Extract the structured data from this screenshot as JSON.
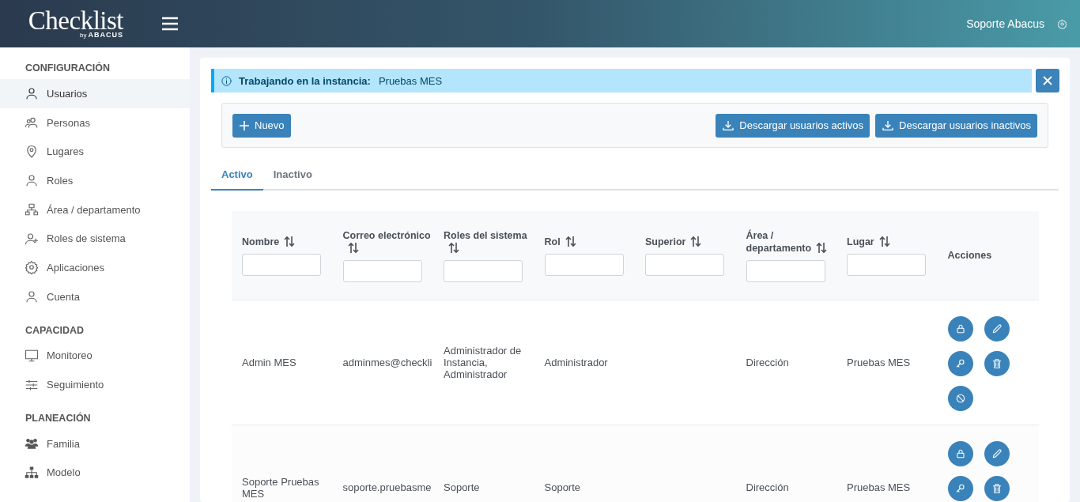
{
  "header": {
    "logo": {
      "title": "Checklist",
      "by": "by",
      "brand": "ABACUS"
    },
    "user": "Soporte Abacus"
  },
  "sidebar": {
    "sections": [
      {
        "title": "CONFIGURACIÓN",
        "items": [
          {
            "label": "Usuarios",
            "kind": "user",
            "selected": true
          },
          {
            "label": "Personas",
            "kind": "users",
            "selected": false
          },
          {
            "label": "Lugares",
            "kind": "pin",
            "selected": false
          },
          {
            "label": "Roles",
            "kind": "user",
            "selected": false
          },
          {
            "label": "Área / departamento",
            "kind": "org",
            "selected": false
          },
          {
            "label": "Roles de sistema",
            "kind": "userplus",
            "selected": false
          },
          {
            "label": "Aplicaciones",
            "kind": "gear",
            "selected": false
          },
          {
            "label": "Cuenta",
            "kind": "user",
            "selected": false
          }
        ]
      },
      {
        "title": "CAPACIDAD",
        "items": [
          {
            "label": "Monitoreo",
            "kind": "monitor",
            "selected": false
          },
          {
            "label": "Seguimiento",
            "kind": "sliders",
            "selected": false
          }
        ]
      },
      {
        "title": "PLANEACIÓN",
        "items": [
          {
            "label": "Familia",
            "kind": "group",
            "selected": false
          },
          {
            "label": "Modelo",
            "kind": "sitemap",
            "selected": false
          }
        ]
      }
    ]
  },
  "notice": {
    "label": "Trabajando en la instancia:",
    "value": "Pruebas MES"
  },
  "toolbar": {
    "new_button": "Nuevo",
    "download_buttons": [
      "Descargar usuarios activos",
      "Descargar usuarios inactivos"
    ]
  },
  "tabs": [
    {
      "label": "Activo",
      "selected": true
    },
    {
      "label": "Inactivo",
      "selected": false
    }
  ],
  "table": {
    "columns": [
      {
        "label": "Nombre",
        "sortable": true,
        "filter": true
      },
      {
        "label": "Correo electrónico",
        "sortable": true,
        "filter": true
      },
      {
        "label": "Roles del sistema",
        "sortable": true,
        "filter": true
      },
      {
        "label": "Rol",
        "sortable": true,
        "filter": true
      },
      {
        "label": "Superior",
        "sortable": true,
        "filter": true
      },
      {
        "label": "Área / departamento",
        "sortable": true,
        "filter": true
      },
      {
        "label": "Lugar",
        "sortable": true,
        "filter": true
      },
      {
        "label": "Acciones",
        "sortable": false,
        "filter": false
      }
    ],
    "rows": [
      {
        "cells": [
          "Admin MES",
          "adminmes@checkli",
          "Administrador de Instancia, Administrador",
          "Administrador",
          "",
          "Dirección",
          "Pruebas MES"
        ],
        "actions": [
          {
            "kind": "lock"
          },
          {
            "kind": "edit"
          },
          {
            "kind": "key"
          },
          {
            "kind": "delete"
          },
          {
            "kind": "disable"
          }
        ]
      },
      {
        "cells": [
          "Soporte Pruebas MES",
          "soporte.pruebasme",
          "Soporte",
          "Soporte",
          "",
          "Dirección",
          "Pruebas MES"
        ],
        "actions": [
          {
            "kind": "lock"
          },
          {
            "kind": "edit"
          },
          {
            "kind": "key"
          },
          {
            "kind": "delete"
          }
        ]
      }
    ]
  }
}
